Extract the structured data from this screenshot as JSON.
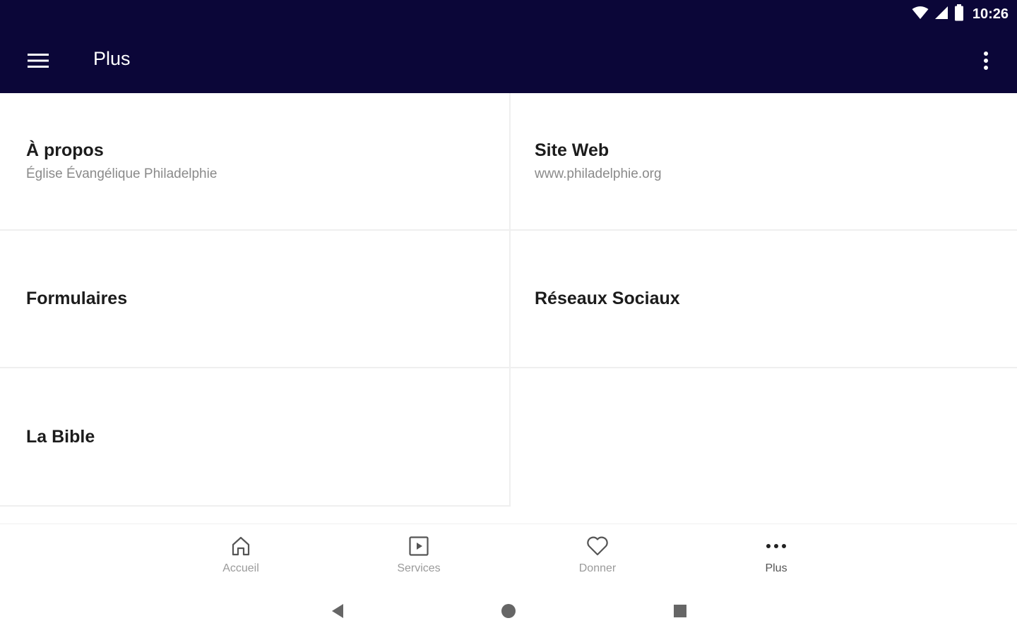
{
  "status_bar": {
    "time": "10:26",
    "icons": [
      "wifi-icon",
      "cellular-signal-icon",
      "battery-icon"
    ]
  },
  "app_bar": {
    "title": "Plus",
    "menu_icon": "hamburger-menu-icon",
    "overflow_icon": "more-vert-icon",
    "background_color": "#0b0638"
  },
  "grid": {
    "items": [
      {
        "title": "À propos",
        "subtitle": "Église Évangélique Philadelphie"
      },
      {
        "title": "Site Web",
        "subtitle": "www.philadelphie.org"
      },
      {
        "title": "Formulaires",
        "subtitle": ""
      },
      {
        "title": "Réseaux Sociaux",
        "subtitle": ""
      },
      {
        "title": "La Bible",
        "subtitle": ""
      }
    ]
  },
  "bottom_nav": {
    "items": [
      {
        "label": "Accueil",
        "icon": "home-icon"
      },
      {
        "label": "Services",
        "icon": "play-box-icon"
      },
      {
        "label": "Donner",
        "icon": "heart-icon"
      },
      {
        "label": "Plus",
        "icon": "more-horiz-icon"
      }
    ],
    "active": "Plus"
  },
  "system_nav": {
    "buttons": [
      "back-icon",
      "home-circle-icon",
      "recents-icon"
    ]
  }
}
